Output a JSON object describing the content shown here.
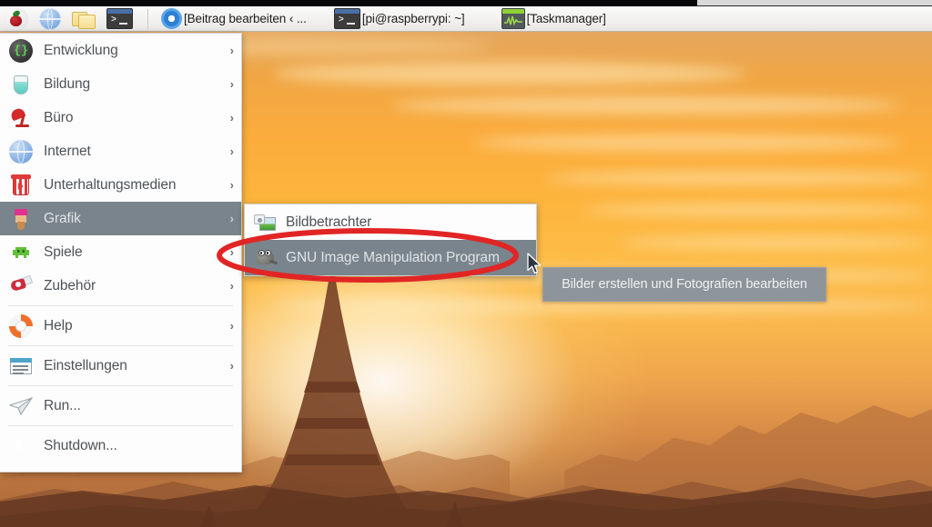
{
  "taskbar": {
    "launchers": [
      {
        "name": "raspberry-menu-icon",
        "label": "",
        "icon": "raspberry-icon"
      },
      {
        "name": "web-browser-launcher",
        "label": "",
        "icon": "globe-icon"
      },
      {
        "name": "file-manager-launcher",
        "label": "",
        "icon": "folder-icon"
      },
      {
        "name": "terminal-launcher",
        "label": "",
        "icon": "terminal-icon"
      }
    ],
    "windows": [
      {
        "label": "[Beitrag bearbeiten ‹ ...",
        "icon": "chromium-icon"
      },
      {
        "label": "[pi@raspberrypi: ~]",
        "icon": "terminal-icon"
      },
      {
        "label": "[Taskmanager]",
        "icon": "taskmanager-icon"
      }
    ]
  },
  "menu": {
    "items": [
      {
        "label": "Entwicklung",
        "icon": "development-icon",
        "arrow": "›",
        "selected": false,
        "separator_after": false
      },
      {
        "label": "Bildung",
        "icon": "education-icon",
        "arrow": "›",
        "selected": false,
        "separator_after": false
      },
      {
        "label": "Büro",
        "icon": "office-icon",
        "arrow": "›",
        "selected": false,
        "separator_after": false
      },
      {
        "label": "Internet",
        "icon": "internet-icon",
        "arrow": "›",
        "selected": false,
        "separator_after": false
      },
      {
        "label": "Unterhaltungsmedien",
        "icon": "multimedia-icon",
        "arrow": "›",
        "selected": false,
        "separator_after": false
      },
      {
        "label": "Grafik",
        "icon": "graphics-icon",
        "arrow": "›",
        "selected": true,
        "separator_after": false
      },
      {
        "label": "Spiele",
        "icon": "games-icon",
        "arrow": "›",
        "selected": false,
        "separator_after": false
      },
      {
        "label": "Zubehör",
        "icon": "accessories-icon",
        "arrow": "›",
        "selected": false,
        "separator_after": true
      },
      {
        "label": "Help",
        "icon": "help-icon",
        "arrow": "›",
        "selected": false,
        "separator_after": true
      },
      {
        "label": "Einstellungen",
        "icon": "preferences-icon",
        "arrow": "›",
        "selected": false,
        "separator_after": true
      },
      {
        "label": "Run...",
        "icon": "run-icon",
        "arrow": "",
        "selected": false,
        "separator_after": true
      },
      {
        "label": "Shutdown...",
        "icon": "shutdown-icon",
        "arrow": "",
        "selected": false,
        "separator_after": false
      }
    ]
  },
  "submenu": {
    "items": [
      {
        "label": "Bildbetrachter",
        "icon": "image-viewer-icon",
        "selected": false
      },
      {
        "label": "GNU Image Manipulation Program",
        "icon": "gimp-icon",
        "selected": true
      }
    ]
  },
  "tooltip": {
    "text": "Bilder erstellen und Fotografien bearbeiten"
  },
  "annotation": {
    "shape": "red-ellipse",
    "color": "#e12525"
  },
  "colors": {
    "menu_background": "#fdfdfd",
    "menu_text": "#4e5357",
    "selection": "#7a848c",
    "tooltip_background": "#8d949a",
    "annotation_red": "#e12525",
    "panel_background": "#f2f1ef",
    "wallpaper_sky": "#fdb43d"
  },
  "wallpaper": {
    "description": "sunset-pagoda-silhouette"
  }
}
